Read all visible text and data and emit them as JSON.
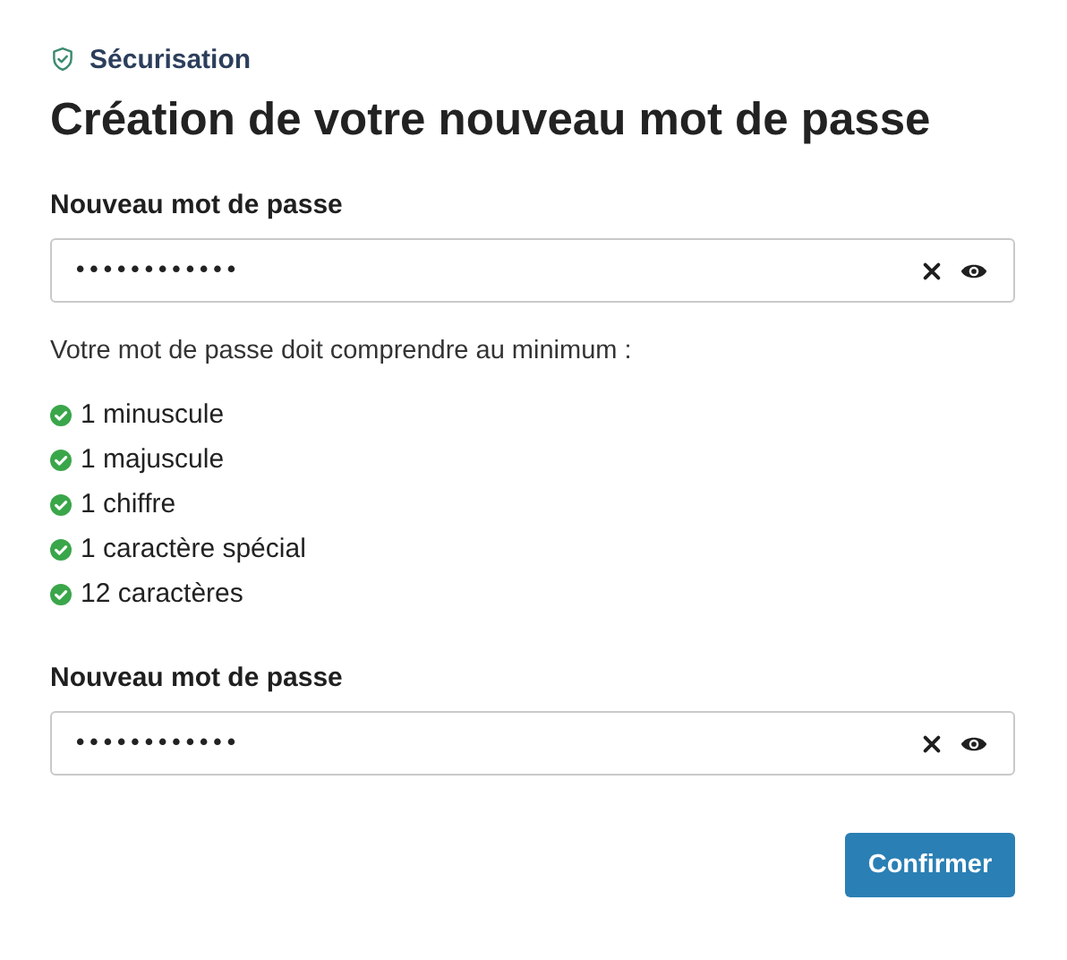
{
  "eyebrow": "Sécurisation",
  "title": "Création de votre nouveau mot de passe",
  "fields": [
    {
      "label": "Nouveau mot de passe",
      "value": "••••••••••••"
    },
    {
      "label": "Nouveau mot de passe",
      "value": "••••••••••••"
    }
  ],
  "requirements_intro": "Votre mot de passe doit comprendre au minimum :",
  "requirements": [
    {
      "text": "1 minuscule",
      "met": true
    },
    {
      "text": "1 majuscule",
      "met": true
    },
    {
      "text": "1 chiffre",
      "met": true
    },
    {
      "text": "1 caractère spécial",
      "met": true
    },
    {
      "text": "12 caractères",
      "met": true
    }
  ],
  "button": "Confirmer"
}
